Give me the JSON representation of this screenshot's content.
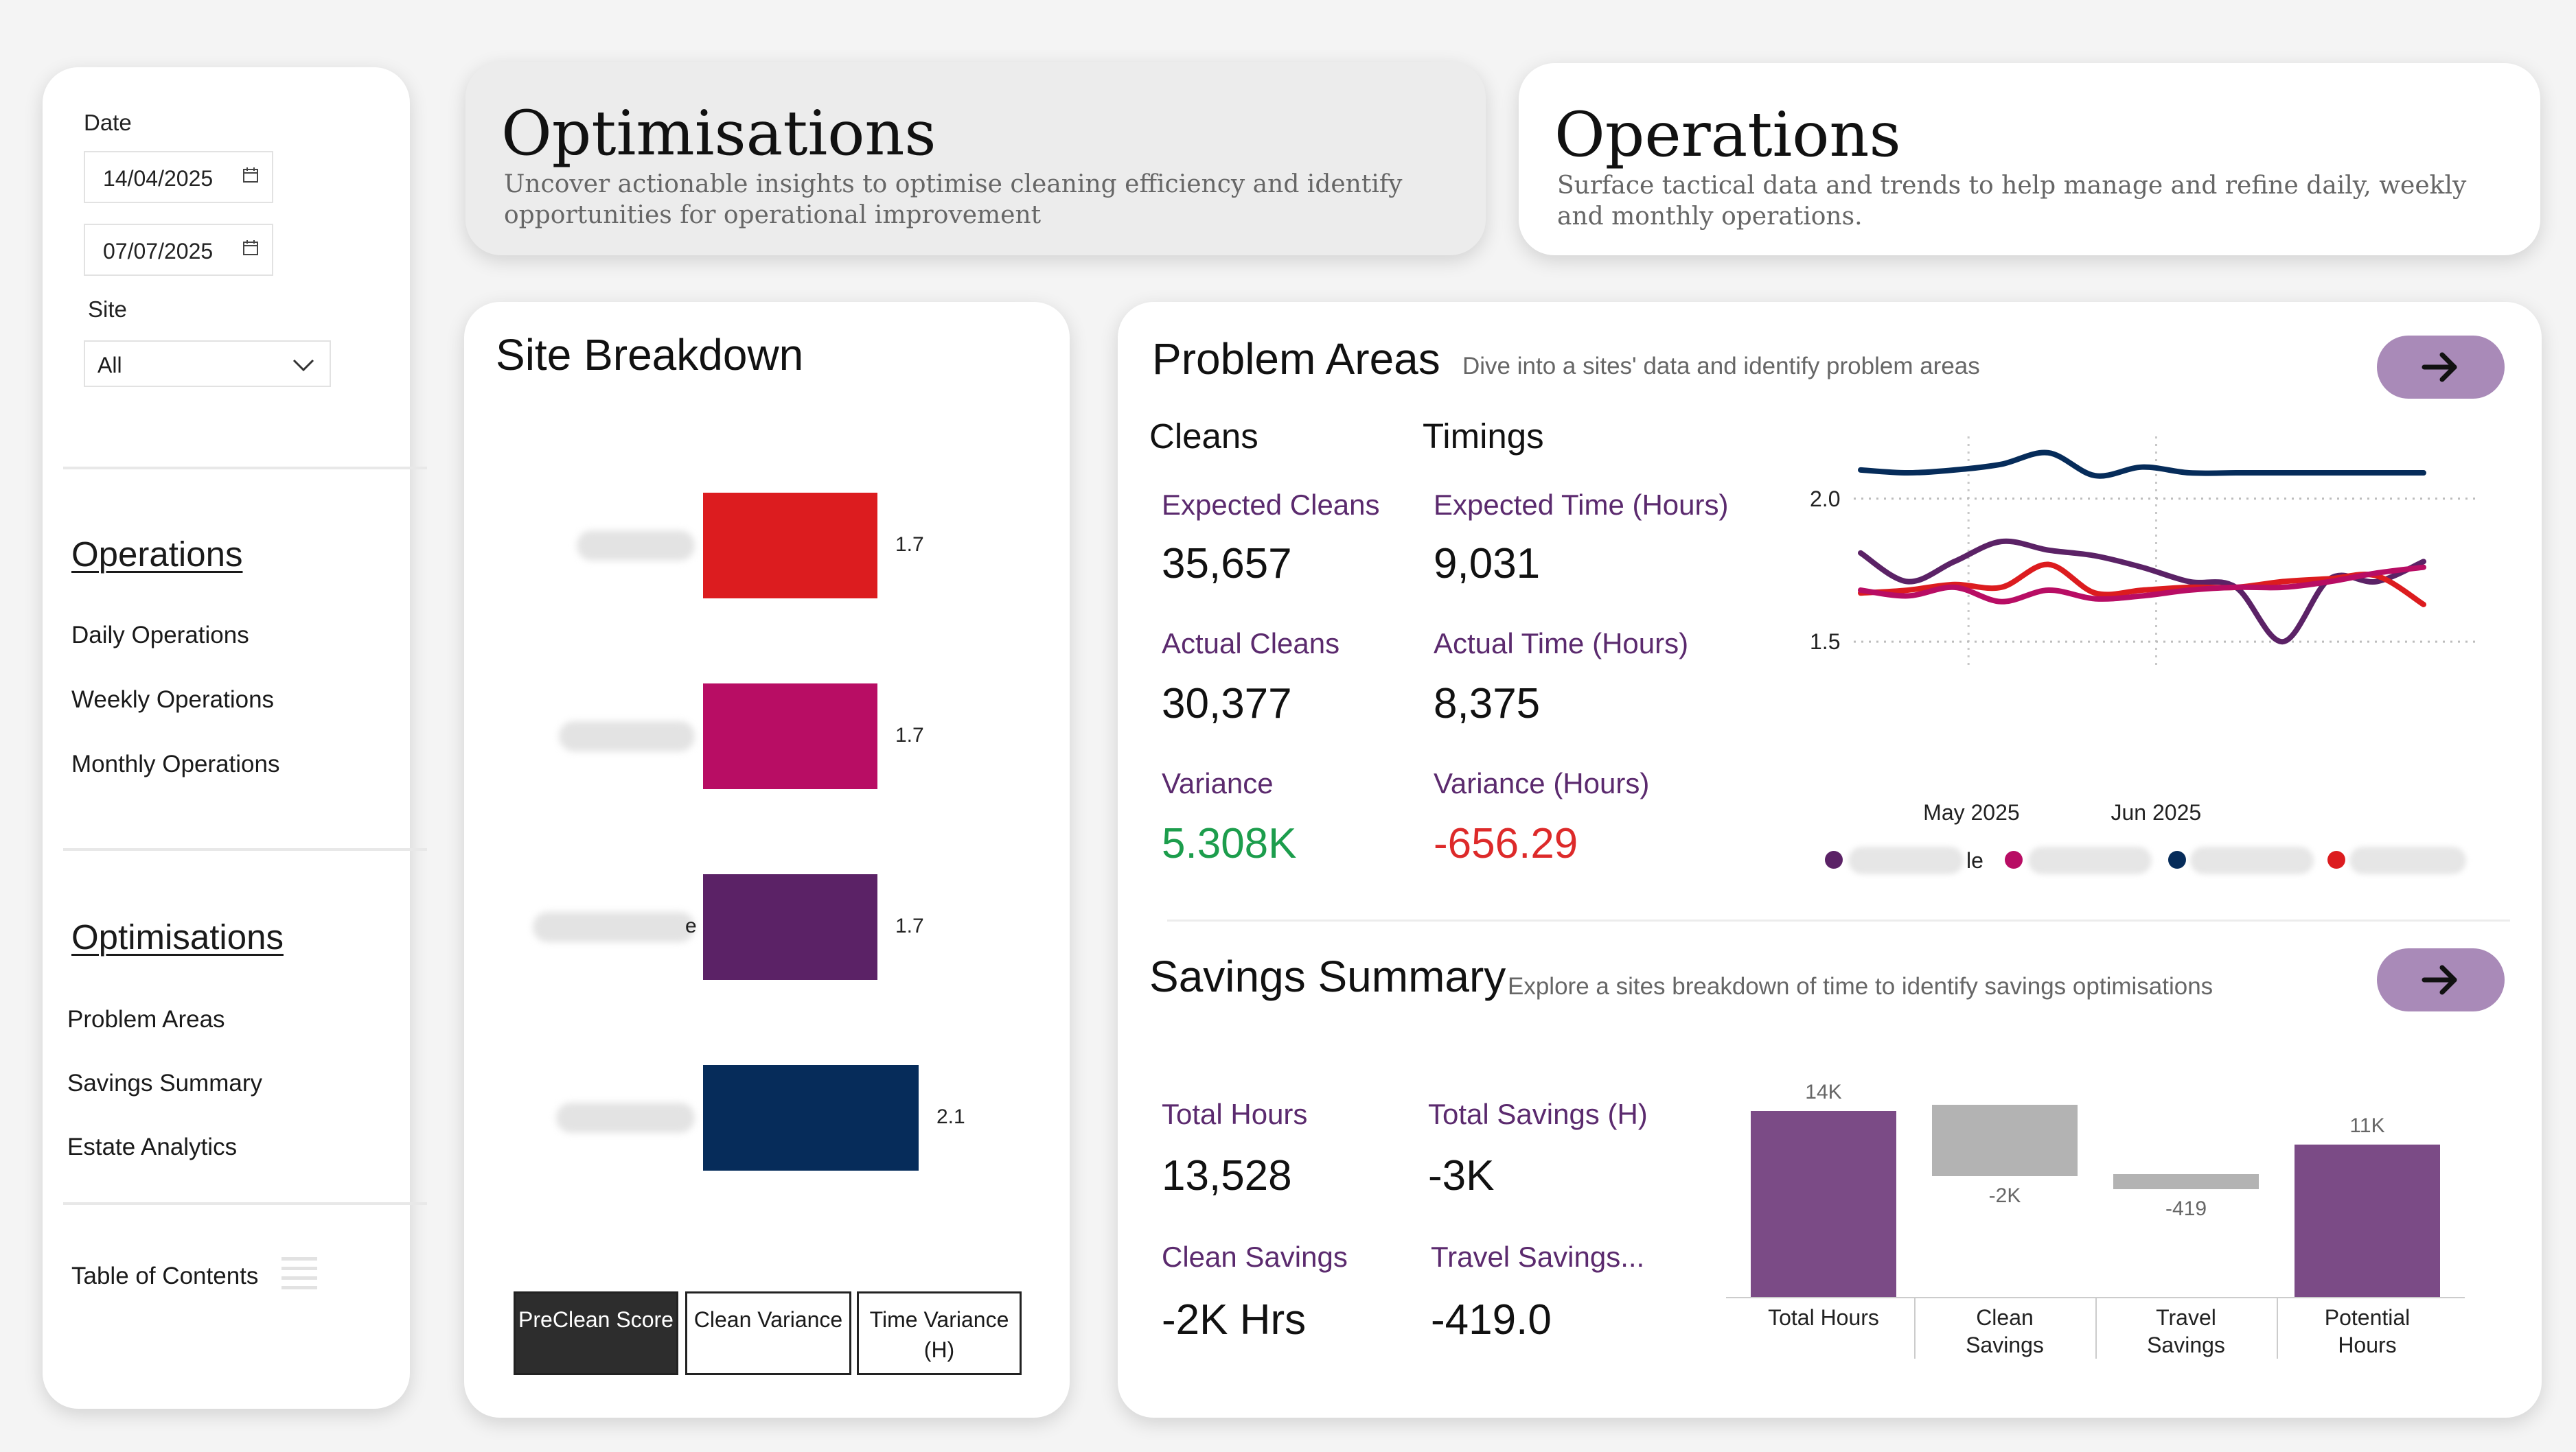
{
  "sidebar": {
    "date_label": "Date",
    "date_start": "14/04/2025",
    "date_end": "07/07/2025",
    "site_label": "Site",
    "site_value": "All",
    "operations_heading": "Operations",
    "operations_items": [
      "Daily Operations",
      "Weekly Operations",
      "Monthly Operations"
    ],
    "optimisations_heading": "Optimisations",
    "optimisations_items": [
      "Problem Areas",
      "Savings Summary",
      "Estate Analytics"
    ],
    "toc_label": "Table of Contents"
  },
  "banners": {
    "optimisations": {
      "title": "Optimisations",
      "description": "Uncover actionable insights to optimise cleaning efficiency and identify opportunities for operational improvement"
    },
    "operations": {
      "title": "Operations",
      "description": "Surface tactical data and trends to help manage and refine daily, weekly and monthly operations."
    }
  },
  "site_breakdown": {
    "title": "Site Breakdown",
    "label_fragments": [
      "",
      "",
      "e",
      ""
    ],
    "buttons": [
      "PreClean Score",
      "Clean Variance",
      "Time Variance (H)"
    ],
    "active_button": 0
  },
  "problem_areas": {
    "title": "Problem Areas",
    "subtitle": "Dive into a sites' data and identify problem areas",
    "cleans_heading": "Cleans",
    "timings_heading": "Timings",
    "expected_cleans_label": "Expected Cleans",
    "expected_cleans_value": "35,657",
    "actual_cleans_label": "Actual Cleans",
    "actual_cleans_value": "30,377",
    "variance_label": "Variance",
    "variance_value": "5.308K",
    "expected_time_label": "Expected Time (Hours)",
    "expected_time_value": "9,031",
    "actual_time_label": "Actual Time (Hours)",
    "actual_time_value": "8,375",
    "variance_hours_label": "Variance (Hours)",
    "variance_hours_value": "-656.29",
    "legend_fragments": [
      "le"
    ]
  },
  "savings_summary": {
    "title": "Savings Summary",
    "subtitle": "Explore a sites breakdown of time to identify savings optimisations",
    "total_hours_label": "Total Hours",
    "total_hours_value": "13,528",
    "total_savings_label": "Total Savings (H)",
    "total_savings_value": "-3K",
    "clean_savings_label": "Clean Savings",
    "clean_savings_value": "-2K Hrs",
    "travel_savings_label": "Travel Savings...",
    "travel_savings_value": "-419.0"
  },
  "colors": {
    "red": "#dc1c1f",
    "magenta": "#b80d64",
    "purple": "#5b2266",
    "navy": "#062c5a",
    "waterfall_purple": "#7b4b86",
    "waterfall_grey": "#b3b3b3",
    "green": "#1c9d4c",
    "arrow_button": "#a98ab8"
  },
  "chart_data": [
    {
      "type": "bar",
      "orientation": "horizontal",
      "categories": [
        "",
        "",
        "",
        ""
      ],
      "values": [
        1.7,
        1.7,
        1.7,
        2.1
      ],
      "value_labels": [
        "1.7",
        "1.7",
        "1.7",
        "2.1"
      ],
      "colors": [
        "#dc1c1f",
        "#b80d64",
        "#5b2266",
        "#062c5a"
      ],
      "xlim": [
        0,
        2.25
      ]
    },
    {
      "type": "line",
      "x": [
        0,
        1,
        2,
        3,
        4,
        5,
        6,
        7,
        8,
        9,
        10,
        11,
        12
      ],
      "x_tick_labels": [
        {
          "x": 2.3,
          "label": "May 2025"
        },
        {
          "x": 6.3,
          "label": "Jun 2025"
        }
      ],
      "y_ticks": [
        {
          "value": 1.5,
          "label": "1.5"
        },
        {
          "value": 2.0,
          "label": "2.0"
        }
      ],
      "ylim": [
        1.45,
        2.15
      ],
      "grid": "dotted",
      "legend": "bottom",
      "series": [
        {
          "color": "#062c5a",
          "values": [
            2.1,
            2.09,
            2.1,
            2.12,
            2.16,
            2.08,
            2.11,
            2.09,
            2.09,
            2.09,
            2.09,
            2.09,
            2.09
          ]
        },
        {
          "color": "#5b2266",
          "values": [
            1.81,
            1.71,
            1.78,
            1.85,
            1.82,
            1.8,
            1.76,
            1.71,
            1.69,
            1.5,
            1.72,
            1.71,
            1.78
          ]
        },
        {
          "color": "#dc1c1f",
          "values": [
            1.67,
            1.68,
            1.7,
            1.69,
            1.77,
            1.67,
            1.68,
            1.69,
            1.69,
            1.71,
            1.72,
            1.73,
            1.63
          ]
        },
        {
          "color": "#b80d64",
          "values": [
            1.68,
            1.66,
            1.69,
            1.64,
            1.68,
            1.65,
            1.66,
            1.68,
            1.69,
            1.69,
            1.71,
            1.74,
            1.76
          ]
        }
      ]
    },
    {
      "type": "bar",
      "subtype": "waterfall",
      "categories": [
        "Total Hours",
        "Clean Savings",
        "Travel Savings",
        "Potential Hours"
      ],
      "values": [
        13528,
        -2000,
        -419,
        11109
      ],
      "value_labels": [
        "14K",
        "-2K",
        "-419",
        "11K"
      ],
      "kinds": [
        "total",
        "delta",
        "delta",
        "total"
      ],
      "ylim": [
        0,
        14500
      ]
    }
  ]
}
